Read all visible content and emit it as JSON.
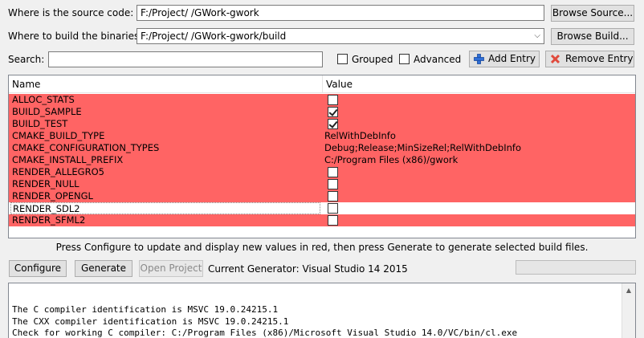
{
  "source": {
    "label": "Where is the source code:",
    "value": "F:/Project/                                        /GWork-gwork",
    "browse_label": "Browse Source..."
  },
  "build": {
    "label": "Where to build the binaries:",
    "value": "F:/Project/                              /GWork-gwork/build",
    "browse_label": "Browse Build..."
  },
  "search": {
    "label": "Search:",
    "value": ""
  },
  "options": {
    "grouped_label": "Grouped",
    "advanced_label": "Advanced",
    "add_entry_label": "Add Entry",
    "remove_entry_label": "Remove Entry"
  },
  "table": {
    "headers": {
      "name": "Name",
      "value": "Value"
    },
    "rows": [
      {
        "name": "ALLOC_STATS",
        "type": "bool",
        "value": "",
        "checked": false,
        "highlight": "red"
      },
      {
        "name": "BUILD_SAMPLE",
        "type": "bool",
        "value": "",
        "checked": true,
        "highlight": "red"
      },
      {
        "name": "BUILD_TEST",
        "type": "bool",
        "value": "",
        "checked": true,
        "highlight": "red"
      },
      {
        "name": "CMAKE_BUILD_TYPE",
        "type": "text",
        "value": "RelWithDebInfo",
        "checked": false,
        "highlight": "red"
      },
      {
        "name": "CMAKE_CONFIGURATION_TYPES",
        "type": "text",
        "value": "Debug;Release;MinSizeRel;RelWithDebInfo",
        "checked": false,
        "highlight": "red"
      },
      {
        "name": "CMAKE_INSTALL_PREFIX",
        "type": "text",
        "value": "C:/Program Files (x86)/gwork",
        "checked": false,
        "highlight": "red"
      },
      {
        "name": "RENDER_ALLEGRO5",
        "type": "bool",
        "value": "",
        "checked": false,
        "highlight": "red"
      },
      {
        "name": "RENDER_NULL",
        "type": "bool",
        "value": "",
        "checked": false,
        "highlight": "red"
      },
      {
        "name": "RENDER_OPENGL",
        "type": "bool",
        "value": "",
        "checked": false,
        "highlight": "red"
      },
      {
        "name": "RENDER_SDL2",
        "type": "bool",
        "value": "",
        "checked": false,
        "highlight": "white"
      },
      {
        "name": "RENDER_SFML2",
        "type": "bool",
        "value": "",
        "checked": false,
        "highlight": "red"
      }
    ]
  },
  "hint": "Press Configure to update and display new values in red, then press Generate to generate selected build files.",
  "actions": {
    "configure_label": "Configure",
    "generate_label": "Generate",
    "open_project_label": "Open Project",
    "generator_text": "Current Generator: Visual Studio 14 2015"
  },
  "output": {
    "lines": [
      "The C compiler identification is MSVC 19.0.24215.1",
      "The CXX compiler identification is MSVC 19.0.24215.1",
      "Check for working C compiler: C:/Program Files (x86)/Microsoft Visual Studio 14.0/VC/bin/cl.exe"
    ]
  },
  "colors": {
    "highlight_red": "#ff6464",
    "add_icon": "#2f6fd6",
    "remove_icon": "#e04a3c"
  },
  "icons": {
    "add_entry": "plus-icon",
    "remove_entry": "x-icon",
    "dropdown": "chevron-down-icon",
    "scroll_up": "arrow-up-icon"
  }
}
